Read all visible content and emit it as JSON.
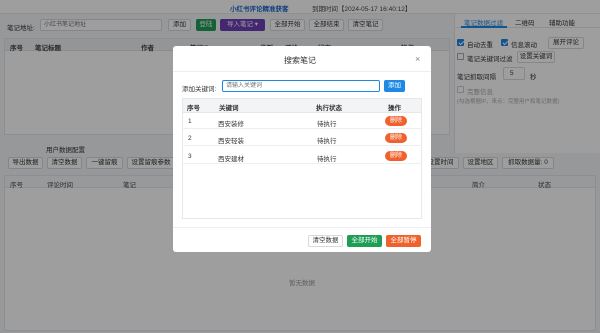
{
  "title": "小红书评论精准获客",
  "expiry": "到期时间【2024-05-17 16:40:12】",
  "toolbar": {
    "url_label": "笔记地址:",
    "url_placeholder": "小红书笔记地址",
    "add": "添加",
    "login": "登陆",
    "import": "导入笔记",
    "start_all": "全部开始",
    "stop_all": "全部结束",
    "clear": "清空笔记"
  },
  "notes_table": {
    "headers": [
      "序号",
      "笔记标题",
      "作者",
      "笔记ID",
      "类型",
      "评论",
      "状态",
      "操作"
    ]
  },
  "side_tabs": [
    "笔记数据过滤",
    "二维码",
    "辅助功能"
  ],
  "side": {
    "auto_dedupe": "自动去重",
    "info_scroll": "信息滚动",
    "expand_comments": "展开评论",
    "note_keyword_filter": "笔记关键词过滤",
    "set_keywords": "设置关键词",
    "interval_label": "笔记抓取间隔",
    "interval_value": "5",
    "interval_unit": "秒",
    "full_info": "完整信息",
    "full_info_hint": "(勾选根据IP，来点：完整用户和笔记数据)"
  },
  "user_section": {
    "title": "用户数据配置",
    "buttons": [
      "导出数据",
      "清空数据",
      "一键留痕",
      "设置留痕参数",
      "设置时间",
      "设置地区",
      "抓取数据量: 0"
    ],
    "headers": [
      "序号",
      "评论时间",
      "笔记",
      "简介",
      "状态"
    ],
    "empty": "暂无数据"
  },
  "dialog": {
    "title": "搜索笔记",
    "kw_label": "添加关键词:",
    "kw_placeholder": "请输入关键词",
    "add": "添加",
    "headers": [
      "序号",
      "关键词",
      "执行状态",
      "操作"
    ],
    "rows": [
      {
        "idx": "1",
        "keyword": "西安装修",
        "status": "待执行",
        "action": "删除"
      },
      {
        "idx": "2",
        "keyword": "西安轻装",
        "status": "待执行",
        "action": "删除"
      },
      {
        "idx": "3",
        "keyword": "西安建材",
        "status": "待执行",
        "action": "删除"
      }
    ],
    "clear": "清空数据",
    "start_all": "全部开始",
    "pause_all": "全部暂停"
  },
  "colors": {
    "green": "#1f9d55",
    "purple": "#6d3fb5",
    "blue": "#1e88e5",
    "orange": "#f0622d"
  }
}
